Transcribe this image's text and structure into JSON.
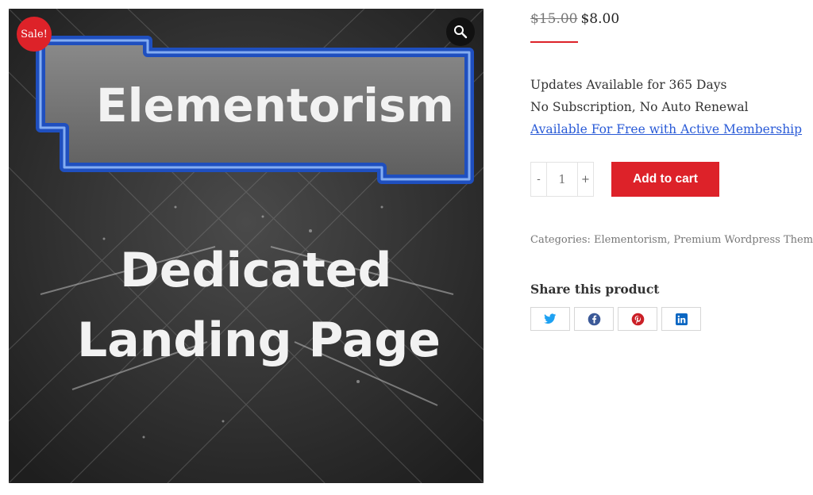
{
  "product_image": {
    "heading": "Elementorism",
    "subheading_line1": "Dedicated",
    "subheading_line2": "Landing Page",
    "sale_badge": "Sale!",
    "zoom_icon": "magnifier-icon"
  },
  "price": {
    "old": "$15.00",
    "new": "$8.00"
  },
  "description": {
    "line1": "Updates Available for 365 Days",
    "line2": "No Subscription, No Auto Renewal",
    "link": "Available For Free with Active Membership"
  },
  "cart": {
    "minus": "-",
    "quantity": "1",
    "plus": "+",
    "add_label": "Add to cart"
  },
  "meta": {
    "text": "Categories: Elementorism, Premium Wordpress Themes  •"
  },
  "share": {
    "title": "Share this product",
    "buttons": [
      "twitter-icon",
      "facebook-icon",
      "pinterest-icon",
      "linkedin-icon"
    ]
  },
  "colors": {
    "accent": "#dd2229",
    "link": "#2a5bd7",
    "twitter": "#1da1f2",
    "facebook": "#3b5998",
    "pinterest": "#cb2027",
    "linkedin": "#0a66c2"
  }
}
